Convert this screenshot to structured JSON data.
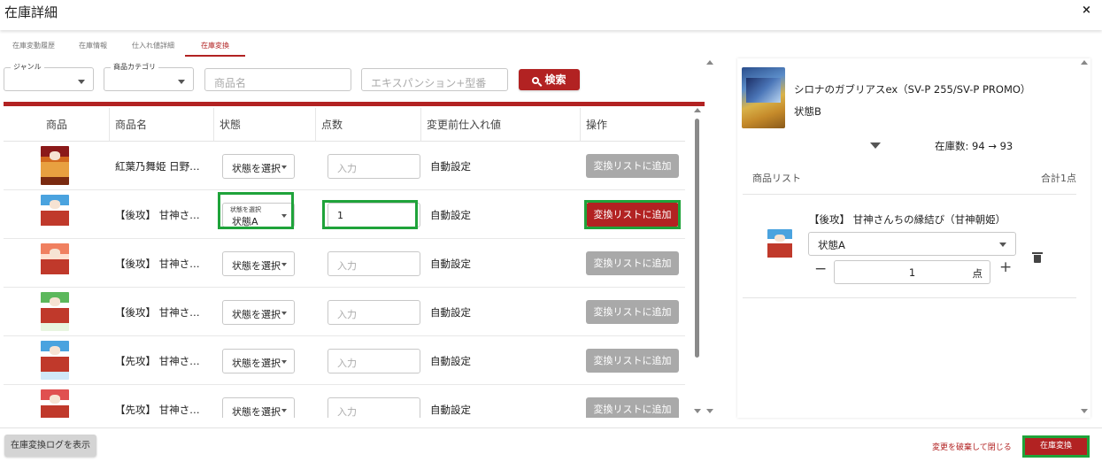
{
  "header": {
    "title": "在庫詳細",
    "close_label": "×"
  },
  "tabs": [
    {
      "label": "在庫変動履歴",
      "active": false
    },
    {
      "label": "在庫情報",
      "active": false
    },
    {
      "label": "仕入れ値詳細",
      "active": false
    },
    {
      "label": "在庫変換",
      "active": true
    }
  ],
  "filters": {
    "genre_label": "ジャンル",
    "category_label": "商品カテゴリ",
    "name_placeholder": "商品名",
    "expansion_placeholder": "エキスパンション+型番",
    "search_label": "検索"
  },
  "table": {
    "headers": [
      "商品",
      "商品名",
      "状態",
      "点数",
      "変更前仕入れ値",
      "操作"
    ],
    "rows": [
      {
        "name": "紅葉乃舞姫 日野下 …",
        "state": "状態を選択",
        "state_legend": "",
        "qty": "入力",
        "qty_filled": false,
        "price": "自動設定",
        "action": "変換リストに追加",
        "active": false,
        "thumb": [
          "#8b1a1a",
          "#d2691e",
          "#e8a040",
          "#7a2a10"
        ]
      },
      {
        "name": "【後攻】 甘神さん…",
        "state": "状態A",
        "state_legend": "状態を選択",
        "qty": "1",
        "qty_filled": true,
        "price": "自動設定",
        "action": "変換リストに追加",
        "active": true,
        "thumb": [
          "#4aa3df",
          "#ffffff",
          "#c0392b",
          "#ffffff"
        ]
      },
      {
        "name": "【後攻】 甘神さん…",
        "state": "状態を選択",
        "state_legend": "",
        "qty": "入力",
        "qty_filled": false,
        "price": "自動設定",
        "action": "変換リストに追加",
        "active": false,
        "thumb": [
          "#f08060",
          "#ffe0d0",
          "#c0392b",
          "#ffffff"
        ]
      },
      {
        "name": "【後攻】 甘神さん…",
        "state": "状態を選択",
        "state_legend": "",
        "qty": "入力",
        "qty_filled": false,
        "price": "自動設定",
        "action": "変換リストに追加",
        "active": false,
        "thumb": [
          "#5cb85c",
          "#ffffff",
          "#c0392b",
          "#e8f5e0"
        ]
      },
      {
        "name": "【先攻】 甘神さん…",
        "state": "状態を選択",
        "state_legend": "",
        "qty": "入力",
        "qty_filled": false,
        "price": "自動設定",
        "action": "変換リストに追加",
        "active": false,
        "thumb": [
          "#4aa3df",
          "#ffffff",
          "#c0392b",
          "#d0e8f8"
        ]
      },
      {
        "name": "【先攻】 甘神さん…",
        "state": "状態を選択",
        "state_legend": "",
        "qty": "入力",
        "qty_filled": false,
        "price": "自動設定",
        "action": "変換リストに追加",
        "active": false,
        "thumb": [
          "#e05050",
          "#ffffff",
          "#c0392b",
          "#f0c0c0"
        ]
      }
    ]
  },
  "right_panel": {
    "product_name": "シロナのガブリアスex（SV-P 255/SV-P PROMO）",
    "product_state": "状態B",
    "stock_text": "在庫数: 94 → 93",
    "list_label": "商品リスト",
    "total_label": "合計1点",
    "item": {
      "name": "【後攻】 甘神さんちの縁結び（甘神朝姫）",
      "state": "状態A",
      "qty": "1",
      "unit": "点",
      "minus": "−",
      "plus": "+"
    }
  },
  "footer": {
    "log_label": "在庫変換ログを表示",
    "discard_label": "変更を破棄して閉じる",
    "submit_label": "在庫変換"
  },
  "colors": {
    "accent": "#b22222",
    "highlight": "#1fa33a",
    "disabled": "#a9a9a9"
  }
}
